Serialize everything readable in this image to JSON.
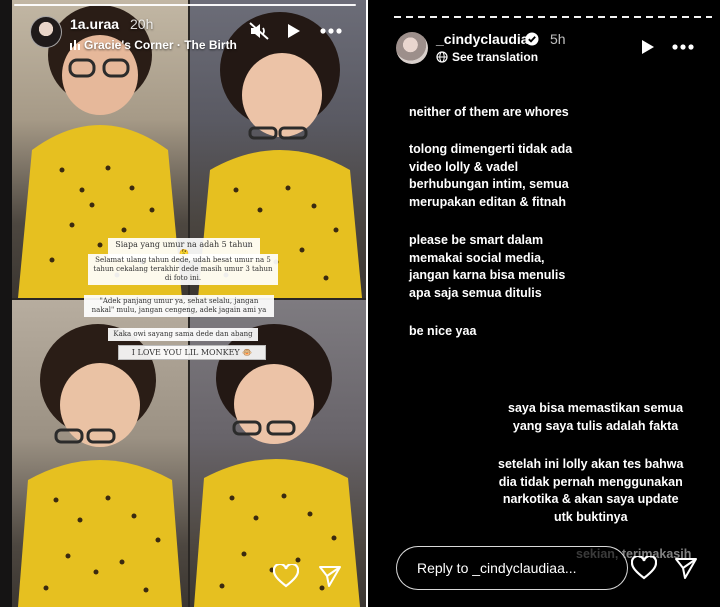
{
  "left_story": {
    "username": "1a.uraa",
    "time": "20h",
    "music": "Gracie's Corner · The Birth",
    "overlay_texts": [
      "Siapa yang umur na adah 5 tahun 🤔",
      "Selamat ulang tahun dede, udah besat umur na 5 tahun cekalang terakhir dede masih umur 3 tahun di foto ini.",
      "\"Adek panjang umur ya, sehat selalu, jangan nakal\" mulu, jangan cengeng, adek jagain ami ya",
      "Kaka owi sayang sama dede dan abang",
      "I LOVE YOU LIL MONKEY 🐵"
    ],
    "icons": {
      "mute": "speaker-muted-icon",
      "play": "play-icon",
      "more": "more-dots-icon",
      "like": "heart-icon",
      "share": "send-icon",
      "music": "music-bars-icon"
    }
  },
  "right_story": {
    "username": "_cindyclaudiaa",
    "verified": true,
    "time": "5h",
    "see_translation": "See translation",
    "paragraphs": [
      "neither of them are whores",
      "tolong dimengerti tidak ada\nvideo lolly & vadel\nberhubungan intim, semua\nmerupakan editan & fitnah",
      "please be smart dalam\nmemakai social media,\njangan karna bisa menulis\napa saja semua ditulis",
      "be nice yaa",
      "saya bisa memastikan semua\nyang saya tulis adalah fakta",
      "setelah ini lolly akan tes bahwa\ndia tidak pernah menggunakan\nnarkotika & akan saya update\nutk buktinya",
      "sekian, terimakasih"
    ],
    "reply_placeholder": "Reply to _cindyclaudiaa...",
    "icons": {
      "play": "play-icon",
      "more": "more-dots-icon",
      "like": "heart-icon",
      "share": "send-icon",
      "translate": "globe-icon",
      "verified": "verified-badge-icon"
    }
  },
  "colors": {
    "right_background": "#000000",
    "text": "#ffffff",
    "verified_blue": "#0095f6",
    "shirt_yellow": "#e8c21e"
  }
}
